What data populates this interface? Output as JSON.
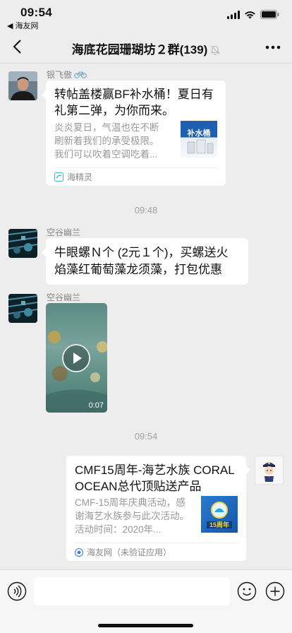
{
  "status": {
    "time": "09:54",
    "back_app": "◀ 海友网"
  },
  "nav": {
    "title": "海底花园珊瑚坊２群(139)"
  },
  "messages": [
    {
      "sender": "银飞傲",
      "type": "link",
      "title": "转帖盖楼赢BF补水桶！夏日有礼第二弹，为你而来。",
      "desc": "炎炎夏日，气温也在不断刷新着我们的承受极限。我们可以吹着空调吃着...",
      "thumb_text": "补水桶",
      "source": "海精灵"
    },
    {
      "time": "09:48"
    },
    {
      "sender": "空谷幽兰",
      "type": "text",
      "text": "牛眼螺Ｎ个 (2元１个)，买螺送火焰藻红葡萄藻龙须藻，打包优惠"
    },
    {
      "sender": "空谷幽兰",
      "type": "video",
      "duration": "0:07"
    },
    {
      "time": "09:54"
    },
    {
      "sender": "",
      "type": "link",
      "title": "CMF15周年-海艺水族 CORAL OCEAN总代顶贴送产品",
      "desc": "CMF-15周年庆典活动，感谢海艺水族参与此次活动。活动时间：2020年...",
      "thumb_text": "15周年",
      "source": "海友网（未验证应用）"
    }
  ]
}
